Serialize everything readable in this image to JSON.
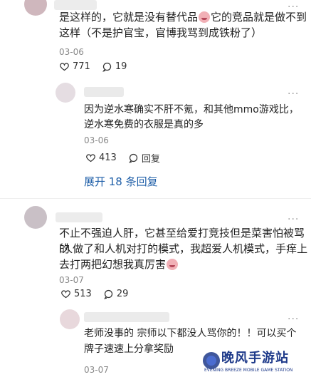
{
  "comments": [
    {
      "text_line1": "是这样的，它就是没有替代品",
      "text_line1b": "它的竞品就是做不到",
      "text_line2": "这样（不是护官宝，官博我骂到成铁粉了）",
      "date": "03-06",
      "likes": "771",
      "replies": "19"
    },
    {
      "text_line1": "因为逆水寒确实不肝不氪，和其他mmo游戏比，",
      "text_line2": "逆水寒免费的衣服是真的多",
      "date": "03-06",
      "likes": "413",
      "reply_label": "回复"
    },
    {
      "text_line1": "不止不强迫人肝，它甚至给爱打竞技但是菜害怕被骂的",
      "text_line2": "i人做了和人机对打的模式，我超爱人机模式，手痒上",
      "text_line3": "去打两把幻想我真厉害",
      "date": "03-07",
      "likes": "513",
      "replies": "29"
    },
    {
      "text_line1": "老师没事的 宗师以下都没人骂你的！！可以买个",
      "text_line2": "牌子速速上分拿奖励",
      "date": "03-07"
    }
  ],
  "expand_label": "展开 18 条回复",
  "watermark": {
    "title": "晚风手游站",
    "subtitle": "EVENING BREEZE MOBILE GAME STATION"
  },
  "colors": {
    "link": "#1f5fa8",
    "muted": "#888888"
  }
}
